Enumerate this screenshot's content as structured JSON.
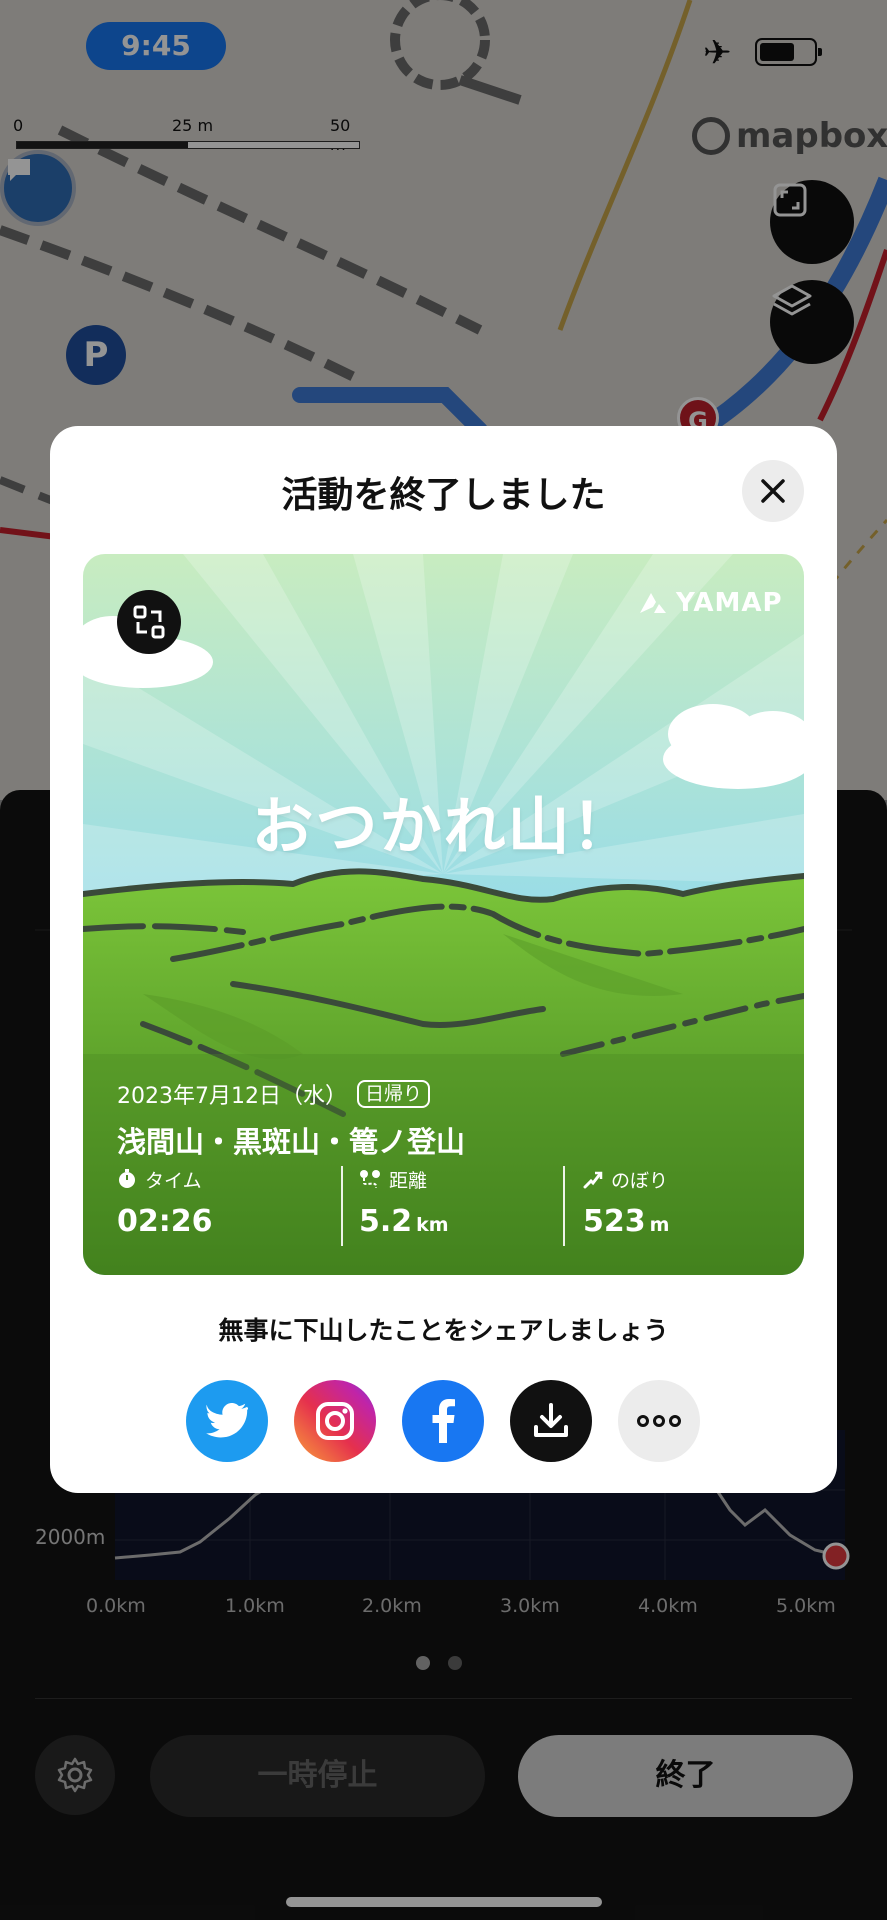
{
  "status_bar": {
    "time": "9:45"
  },
  "map": {
    "scale_labels": [
      "0",
      "25 m",
      "50 m"
    ],
    "attribution": "mapbox",
    "parking_label": "P",
    "marker_label": "G"
  },
  "modal": {
    "title": "活動を終了しました",
    "card": {
      "brand": "YAMAP",
      "headline": "おつかれ山！",
      "date": "2023年7月12日（水）",
      "trip_type": "日帰り",
      "mountains": "浅間山・黒斑山・篭ノ登山",
      "stats": [
        {
          "label": "タイム",
          "value": "02:26",
          "unit": ""
        },
        {
          "label": "距離",
          "value": "5.2",
          "unit": "km"
        },
        {
          "label": "のぼり",
          "value": "523",
          "unit": "m"
        }
      ]
    },
    "share_prompt": "無事に下山したことをシェアしましょう",
    "share_targets": [
      "twitter-icon",
      "instagram-icon",
      "facebook-icon",
      "download-icon",
      "more-icon"
    ]
  },
  "elevation_chart": {
    "y_labels": [
      "2000m"
    ],
    "x_labels": [
      "0.0km",
      "1.0km",
      "2.0km",
      "3.0km",
      "4.0km",
      "5.0km"
    ]
  },
  "controls": {
    "pause_label": "一時停止",
    "end_label": "終了"
  },
  "colors": {
    "accent_blue": "#1877f2",
    "twitter": "#1d9bf0",
    "facebook": "#1877f2",
    "marker_red": "#c0202b"
  }
}
